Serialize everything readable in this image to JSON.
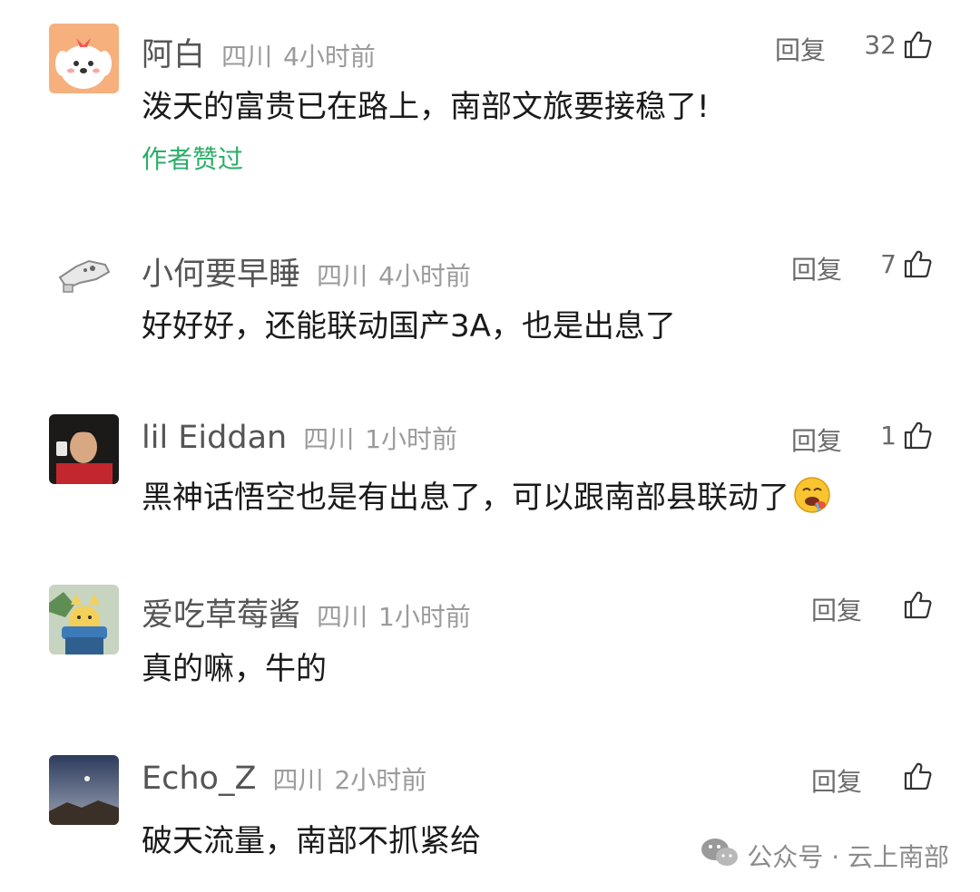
{
  "reply_label": "回复",
  "comments": [
    {
      "nickname": "阿白",
      "location": "四川",
      "time": "4小时前",
      "likes": "32",
      "content": "泼天的富贵已在路上，南部文旅要接稳了!",
      "badge": "作者赞过"
    },
    {
      "nickname": "小何要早睡",
      "location": "四川",
      "time": "4小时前",
      "likes": "7",
      "content": "好好好，还能联动国产3A，也是出息了"
    },
    {
      "nickname": "lil Eiddan",
      "location": "四川",
      "time": "1小时前",
      "likes": "1",
      "content": "黑神话悟空也是有出息了，可以跟南部县联动了",
      "emoji": "drooling-face-icon"
    },
    {
      "nickname": "爱吃草莓酱",
      "location": "四川",
      "time": "1小时前",
      "likes": "",
      "content": "真的嘛，牛的"
    },
    {
      "nickname": "Echo_Z",
      "location": "四川",
      "time": "2小时前",
      "likes": "",
      "content": "破天流量，南部不抓紧给"
    }
  ],
  "watermark": {
    "text": "公众号 · 云上南部",
    "icon": "wechat-icon"
  },
  "colors": {
    "badge": "#2aae67",
    "meta": "#9b9b9b",
    "text": "#1a1a1a"
  }
}
